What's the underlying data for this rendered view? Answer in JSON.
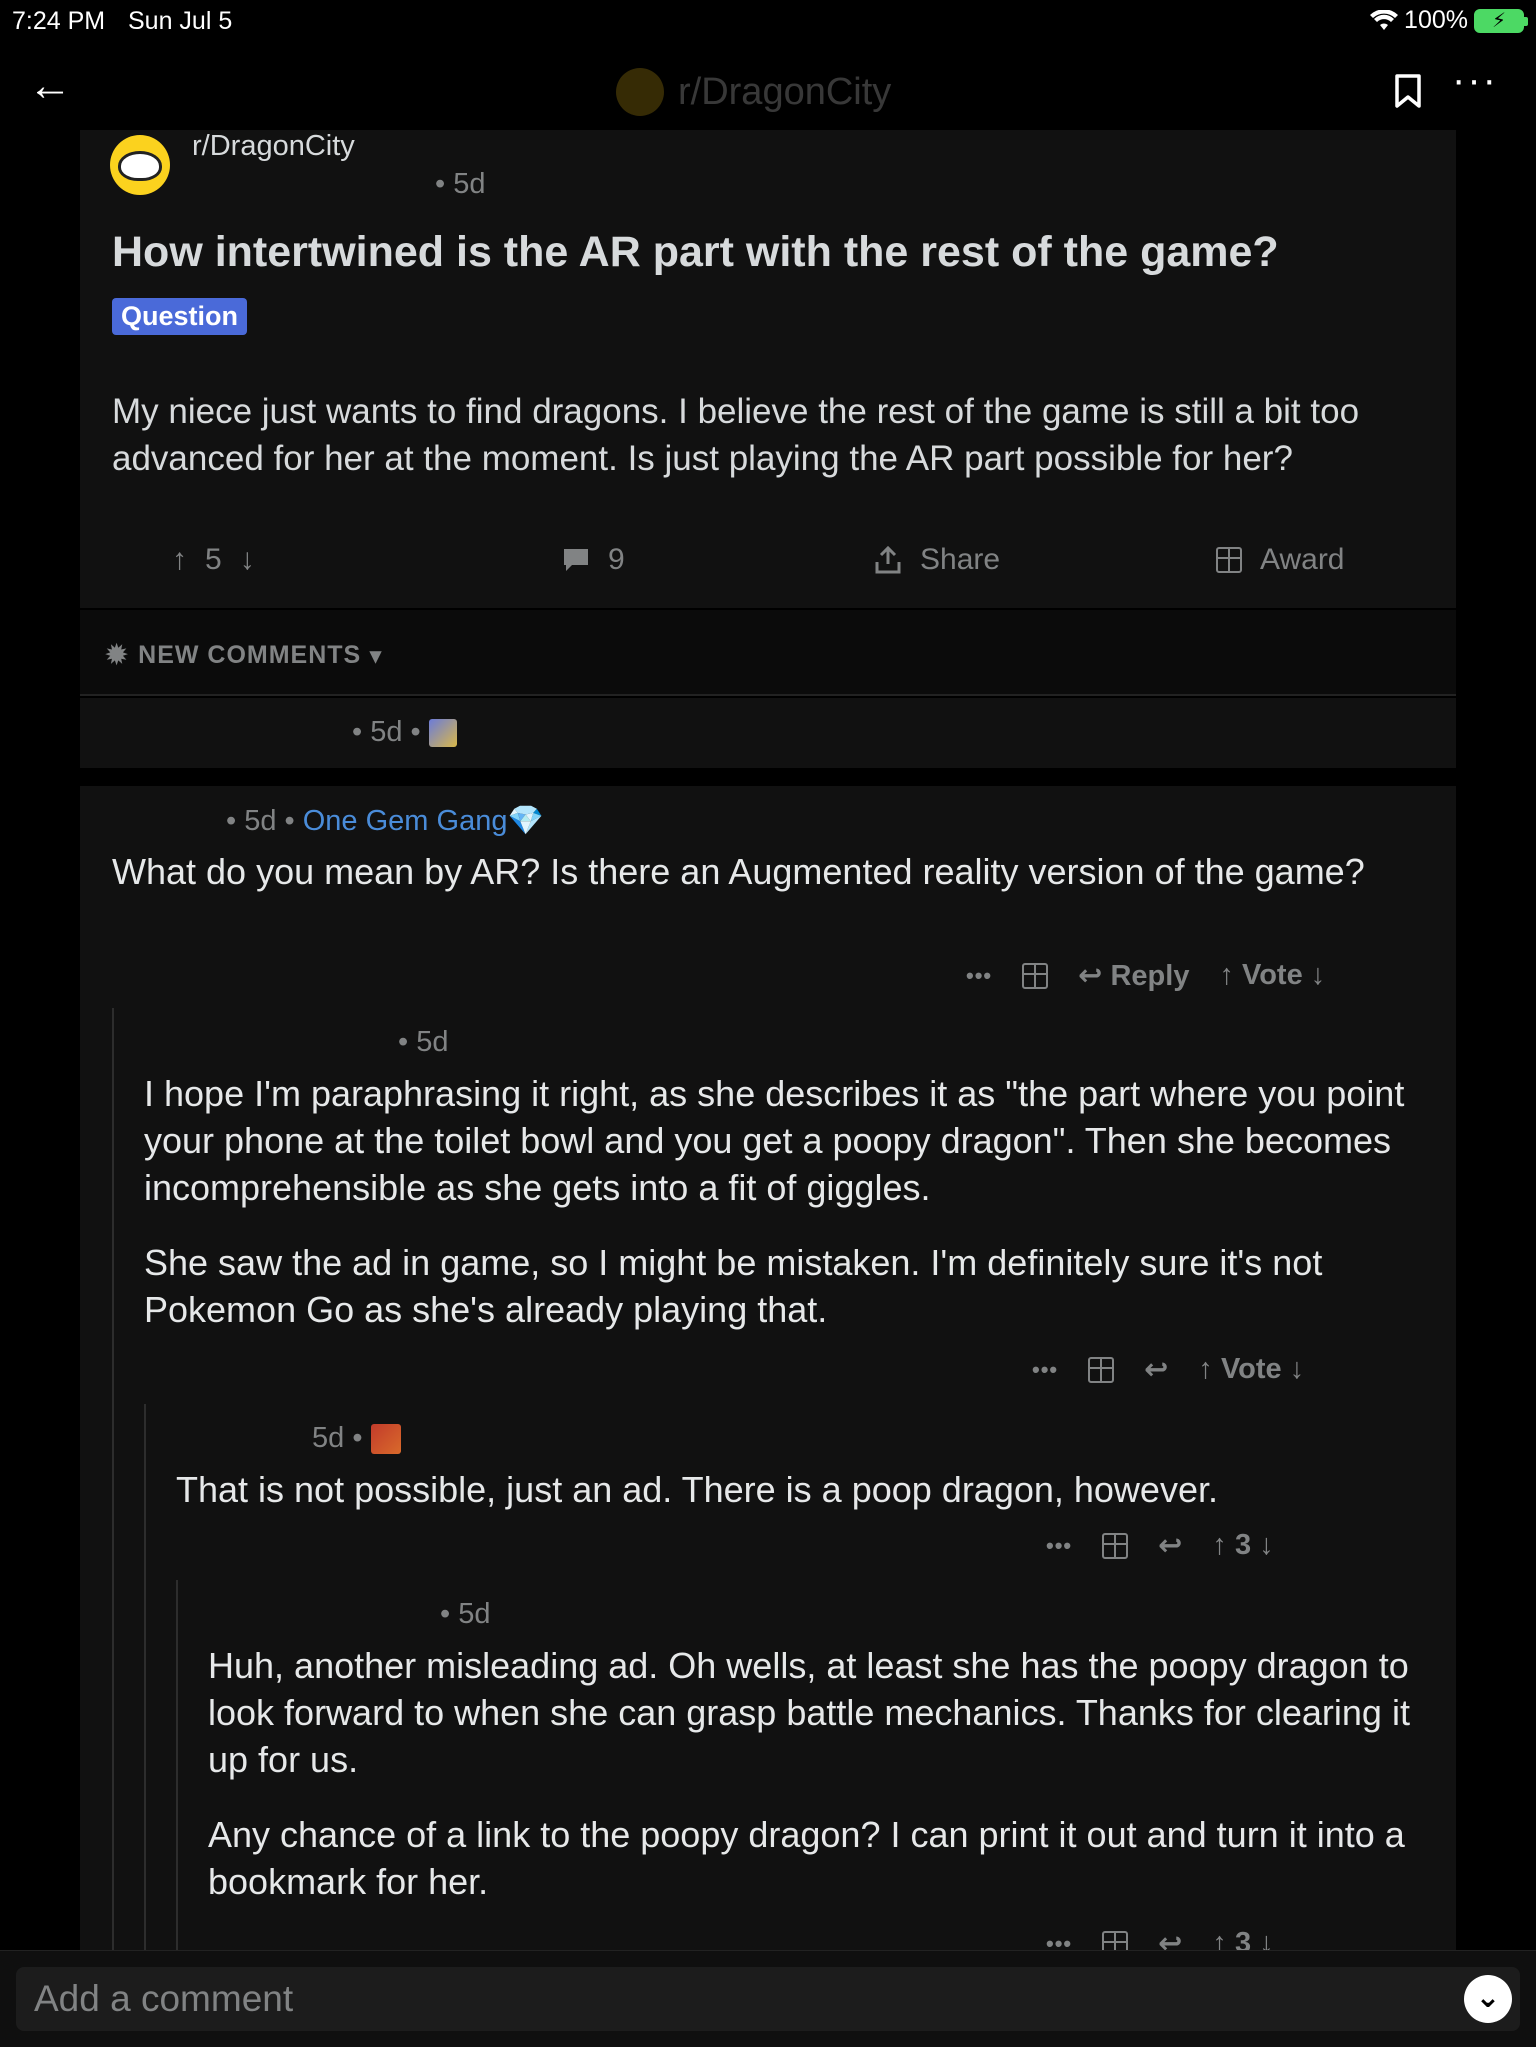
{
  "status_bar": {
    "time": "7:24 PM",
    "date": "Sun Jul 5",
    "battery": "100%"
  },
  "nav": {
    "subreddit": "r/DragonCity"
  },
  "post": {
    "subreddit": "r/DragonCity",
    "meta": "• 5d",
    "title": "How intertwined is the AR part with the rest of the game?",
    "flair": "Question",
    "body": "My niece just wants to find dragons.  I believe the rest of the game is still a bit too advanced for her at the moment.  Is just playing the AR part possible for her?",
    "score": "5",
    "comments": "9",
    "share_label": "Share",
    "award_label": "Award"
  },
  "sort": {
    "label": "NEW COMMENTS"
  },
  "collapsed": {
    "meta": "• 5d •"
  },
  "comments": [
    {
      "meta": "• 5d •",
      "flair": "One Gem Gang💎",
      "body": [
        "What do you mean by AR? Is there an Augmented reality version of the game?"
      ],
      "reply_label": "Reply",
      "vote_label": "Vote"
    },
    {
      "meta": "• 5d",
      "body": [
        "I hope I'm paraphrasing it right, as she describes it as \"the part where you point your phone at the toilet bowl and you get a poopy dragon\".  Then she becomes incomprehensible as she gets into a fit of giggles.",
        "She saw the ad in game, so I might be mistaken.  I'm definitely sure it's not Pokemon Go as she's already playing that."
      ],
      "vote_label": "Vote"
    },
    {
      "meta": "5d •",
      "body": [
        "That is not possible, just an ad. There is a poop dragon, however."
      ],
      "score": "3"
    },
    {
      "meta": "• 5d",
      "body": [
        "Huh, another misleading ad.  Oh wells, at least she has the poopy dragon to look forward to when she can grasp battle mechanics. Thanks for clearing it up for us.",
        "Any chance of a link to the poopy dragon?  I can print it out and turn it into a bookmark for her."
      ],
      "score": "3"
    }
  ],
  "comment_bar": {
    "placeholder": "Add a comment"
  },
  "icons": {
    "arrow_up": "↑",
    "arrow_down": "↓",
    "reply": "↩",
    "back": "←",
    "chevron": "»"
  }
}
